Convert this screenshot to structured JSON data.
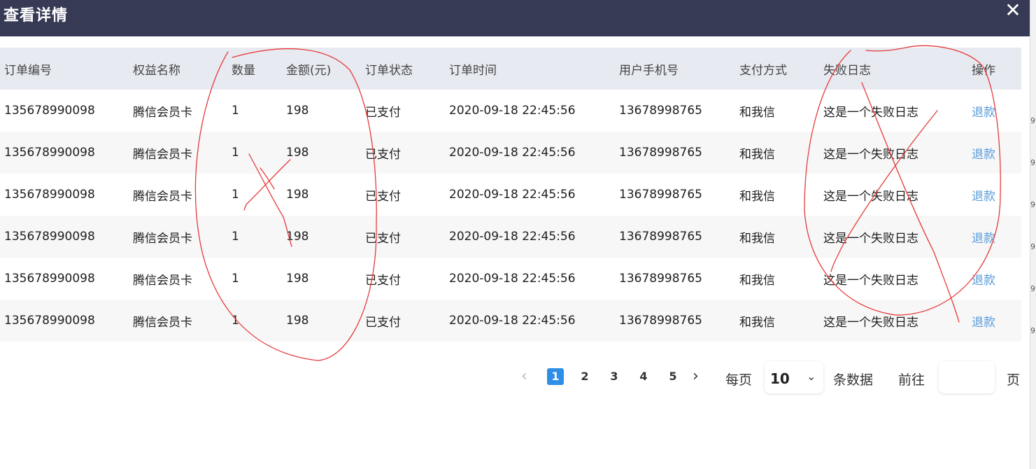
{
  "dialog": {
    "title": "查看详情",
    "close_icon": "close-icon"
  },
  "table": {
    "columns": [
      "订单编号",
      "权益名称",
      "数量",
      "金额(元)",
      "订单状态",
      "订单时间",
      "用户手机号",
      "支付方式",
      "失败日志",
      "操作"
    ],
    "rows": [
      [
        "135678990098",
        "腾信会员卡",
        "1",
        "198",
        "已支付",
        "2020-09-18 22:45:56",
        "13678998765",
        "和我信",
        "这是一个失败日志",
        "退款"
      ],
      [
        "135678990098",
        "腾信会员卡",
        "1",
        "198",
        "已支付",
        "2020-09-18 22:45:56",
        "13678998765",
        "和我信",
        "这是一个失败日志",
        "退款"
      ],
      [
        "135678990098",
        "腾信会员卡",
        "1",
        "198",
        "已支付",
        "2020-09-18 22:45:56",
        "13678998765",
        "和我信",
        "这是一个失败日志",
        "退款"
      ],
      [
        "135678990098",
        "腾信会员卡",
        "1",
        "198",
        "已支付",
        "2020-09-18 22:45:56",
        "13678998765",
        "和我信",
        "这是一个失败日志",
        "退款"
      ],
      [
        "135678990098",
        "腾信会员卡",
        "1",
        "198",
        "已支付",
        "2020-09-18 22:45:56",
        "13678998765",
        "和我信",
        "这是一个失败日志",
        "退款"
      ],
      [
        "135678990098",
        "腾信会员卡",
        "1",
        "198",
        "已支付",
        "2020-09-18 22:45:56",
        "13678998765",
        "和我信",
        "这是一个失败日志",
        "退款"
      ]
    ]
  },
  "pagination": {
    "pages": [
      "1",
      "2",
      "3",
      "4",
      "5"
    ],
    "current_page": "1",
    "per_page_label": "每页",
    "page_size": "10",
    "records_label": "条数据",
    "goto_label": "前往",
    "page_suffix": "页",
    "goto_value": ""
  },
  "colors": {
    "header_bar": "#363a55",
    "table_header_bg": "#e8eaf2",
    "link": "#5a9bd8",
    "active_page": "#2f8fe6",
    "annotation_stroke": "#e53a3a"
  }
}
